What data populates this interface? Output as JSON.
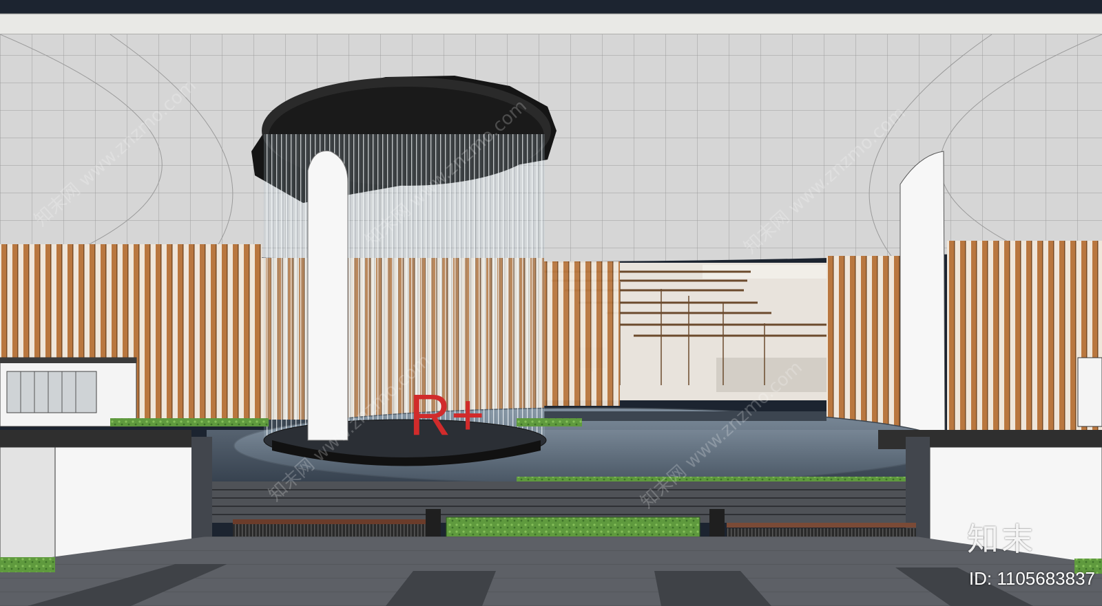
{
  "watermark": {
    "logo_text": "知末",
    "id_text": "ID: 1105683837",
    "diagonal_text": "知末网 www.znzmo.com"
  },
  "sign": {
    "text": "R+"
  },
  "colors": {
    "sky": "#1c2430",
    "canopy": "#d7d7d7",
    "wood": "#b9773f",
    "sign_red": "#d12b2b",
    "grass": "#5e9b3f",
    "water": "#5f6f80",
    "paving": "#6a6d72"
  }
}
